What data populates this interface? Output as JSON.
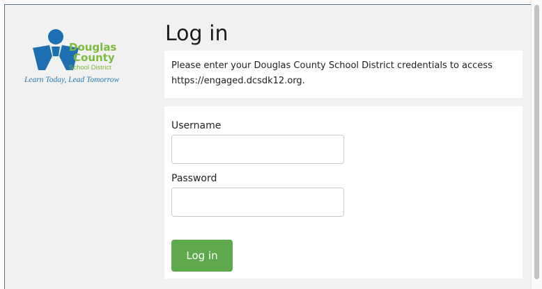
{
  "logo": {
    "line1": "Douglas",
    "line2": "County",
    "line3": "School District",
    "tagline": "Learn Today, Lead Tomorrow",
    "colors": {
      "blue": "#1e6fb2",
      "green": "#7dbb3e"
    }
  },
  "page": {
    "title": "Log in",
    "info_text": "Please enter your Douglas County School District credentials to access https://engaged.dcsdk12.org."
  },
  "form": {
    "username_label": "Username",
    "username_value": "",
    "password_label": "Password",
    "password_value": "",
    "submit_label": "Log in",
    "submit_color": "#5fa94d"
  }
}
